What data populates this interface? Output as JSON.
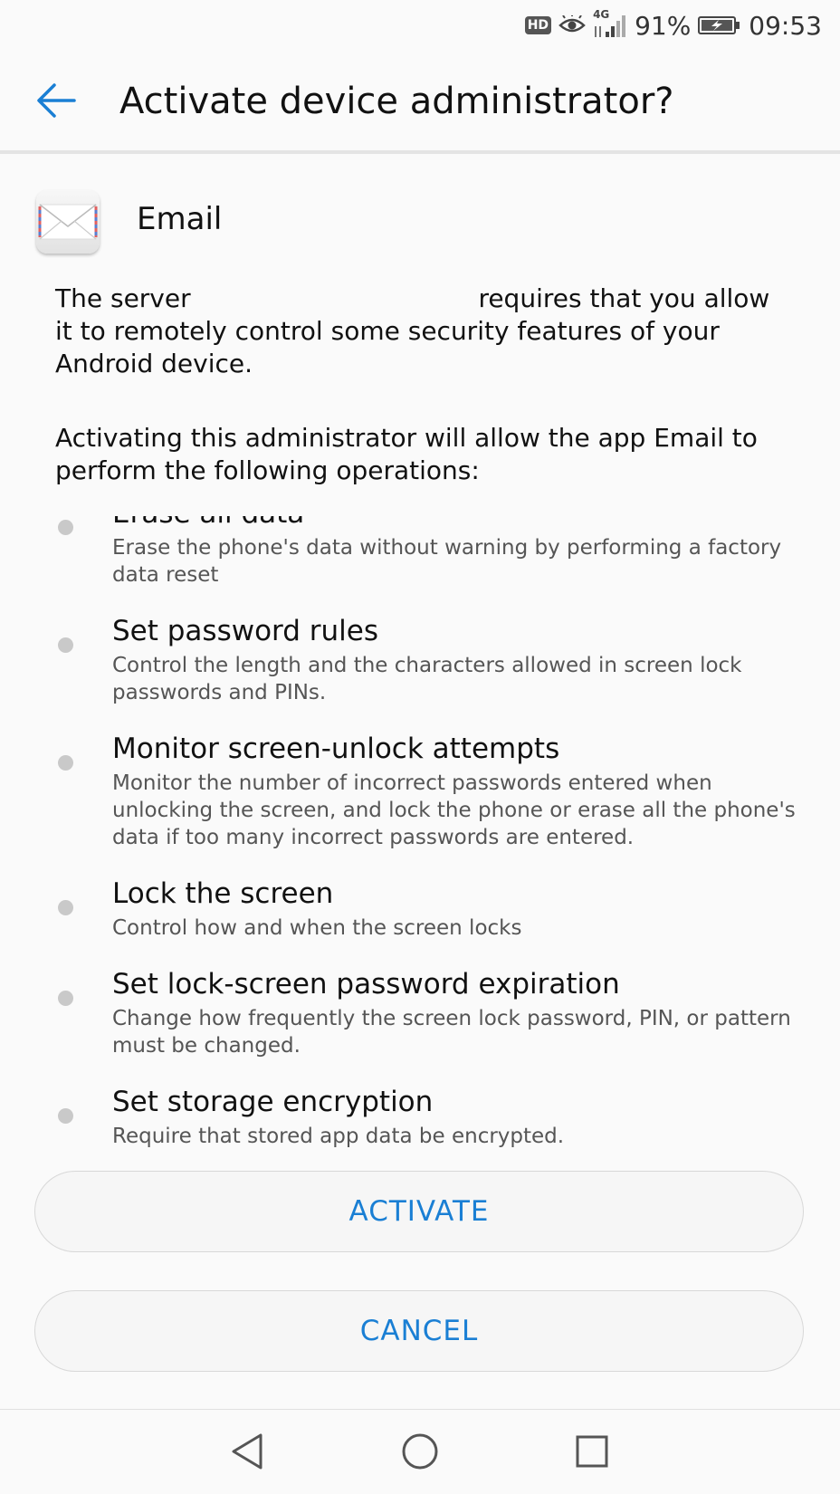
{
  "status_bar": {
    "hd": "HD",
    "network": "4G",
    "battery": "91%",
    "time": "09:53",
    "icons": [
      "hd-icon",
      "eye-comfort-icon",
      "signal-icon",
      "battery-charging-icon"
    ]
  },
  "header": {
    "title": "Activate device administrator?",
    "back_icon": "arrow-back-icon"
  },
  "app": {
    "name": "Email",
    "icon": "email-envelope-icon"
  },
  "description": {
    "server_prefix": "The server",
    "server_suffix": "requires that you allow it to remotely control some security features of your Android device.",
    "activating": "Activating this administrator will allow the app Email to perform the following operations:"
  },
  "permissions": [
    {
      "title": "Erase all data",
      "desc": "Erase the phone's data without warning by performing a factory data reset"
    },
    {
      "title": "Set password rules",
      "desc": "Control the length and the characters allowed in screen lock passwords and PINs."
    },
    {
      "title": "Monitor screen-unlock attempts",
      "desc": "Monitor the number of incorrect passwords entered when unlocking the screen, and lock the phone or erase all the phone's data if too many incorrect passwords are entered."
    },
    {
      "title": "Lock the screen",
      "desc": "Control how and when the screen locks"
    },
    {
      "title": "Set lock-screen password expiration",
      "desc": "Change how frequently the screen lock password, PIN, or pattern must be changed."
    },
    {
      "title": "Set storage encryption",
      "desc": "Require that stored app data be encrypted."
    }
  ],
  "buttons": {
    "activate": "ACTIVATE",
    "cancel": "CANCEL"
  },
  "nav": {
    "back_icon": "nav-back-icon",
    "home_icon": "nav-home-icon",
    "recents_icon": "nav-recents-icon"
  },
  "colors": {
    "accent": "#1a7fd4",
    "background": "#fafafa",
    "bullet": "#c9c9c9"
  }
}
